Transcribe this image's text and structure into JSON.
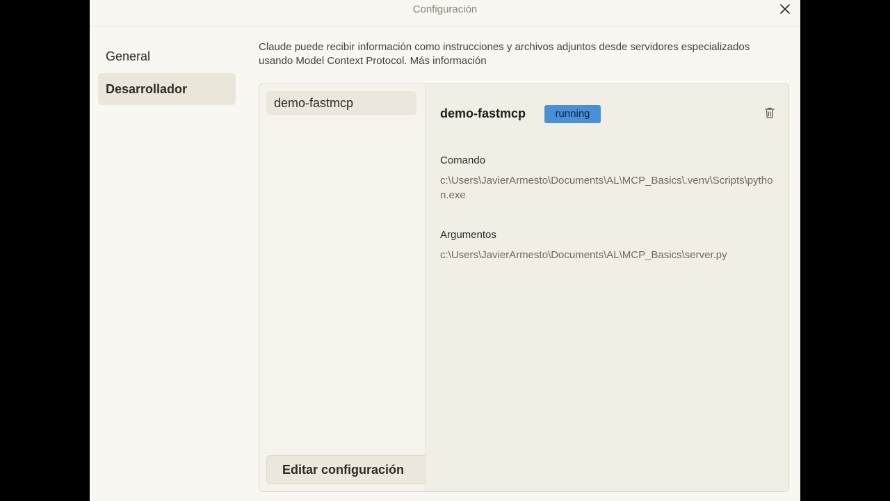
{
  "window": {
    "title": "Configuración"
  },
  "sidebar": {
    "items": [
      {
        "label": "General",
        "active": false
      },
      {
        "label": "Desarrollador",
        "active": true
      }
    ]
  },
  "description": "Claude puede recibir información como instrucciones y archivos adjuntos desde servidores especializados usando Model Context Protocol. Más información",
  "servers": [
    {
      "name": "demo-fastmcp"
    }
  ],
  "edit_button": "Editar configuración",
  "detail": {
    "name": "demo-fastmcp",
    "status": "running",
    "command_label": "Comando",
    "command_value": "c:\\Users\\JavierArmesto\\Documents\\AL\\MCP_Basics\\.venv\\Scripts\\python.exe",
    "args_label": "Argumentos",
    "args_value": "c:\\Users\\JavierArmesto\\Documents\\AL\\MCP_Basics\\server.py"
  },
  "colors": {
    "status_badge": "#4a90d9",
    "active_item": "#ebe6da",
    "window_bg": "#f8f7f2"
  },
  "icons": {
    "close": "close-icon",
    "delete": "trash-icon"
  }
}
